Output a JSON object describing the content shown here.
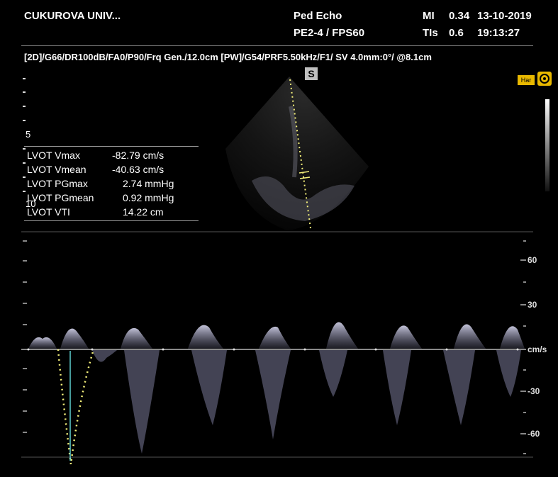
{
  "header": {
    "institution": "CUKUROVA UNIV...",
    "preset": "Ped Echo",
    "probe_fps": "PE2-4 / FPS60",
    "mi_label": "MI",
    "mi_value": "0.34",
    "date": "13-10-2019",
    "tis_label": "TIs",
    "tis_value": "0.6",
    "time": "19:13:27"
  },
  "params_line": "[2D]/G66/DR100dB/FA0/P90/Frq Gen./12.0cm   [PW]/G54/PRF5.50kHz/F1/ SV 4.0mm:0°/ @8.1cm",
  "sample_volume_marker": "S",
  "harmonic_label": "Har",
  "depth_labels": [
    "5",
    "10"
  ],
  "measurements": [
    {
      "label": "LVOT Vmax",
      "value": "-82.79 cm/s"
    },
    {
      "label": "LVOT Vmean",
      "value": "-40.63 cm/s"
    },
    {
      "label": "LVOT PGmax",
      "value": "2.74 mmHg"
    },
    {
      "label": "LVOT PGmean",
      "value": "0.92 mmHg"
    },
    {
      "label": "LVOT VTI",
      "value": "14.22 cm"
    }
  ],
  "velocity_scale": {
    "unit": "cm/s",
    "ticks": [
      "60",
      "30",
      "-30",
      "-60"
    ]
  },
  "colors": {
    "background": "#000000",
    "trace_dots": "#f4f07a",
    "cursor_line": "#5fd0d0",
    "harmonic_badge": "#e8b800"
  }
}
